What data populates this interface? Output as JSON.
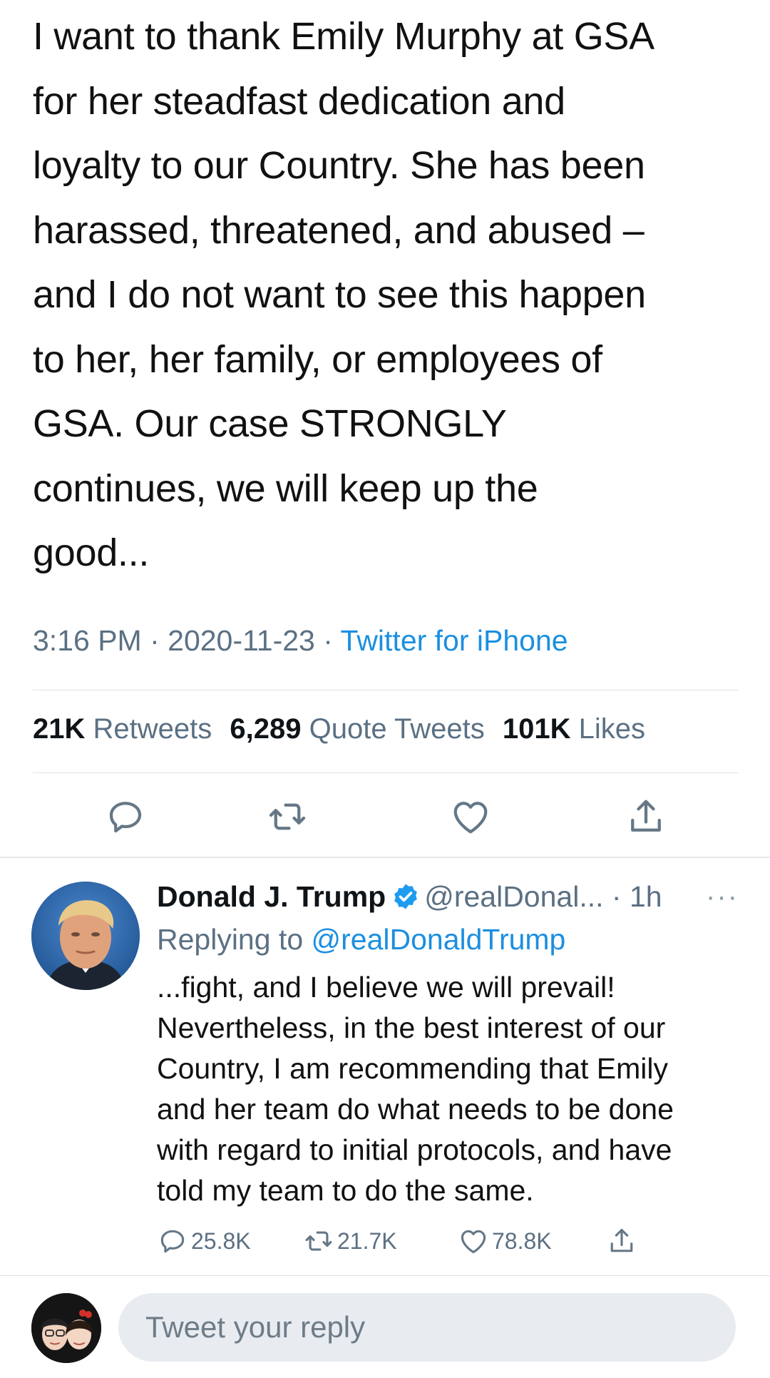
{
  "main_tweet": {
    "text_lines": [
      "I want to thank Emily Murphy at GSA",
      "for her steadfast dedication and",
      "loyalty to our Country. She has been",
      "harassed, threatened, and abused –",
      "and I do not want to see this happen",
      "to her, her family, or employees of",
      "GSA. Our case STRONGLY",
      "continues, we will keep up the",
      "good..."
    ],
    "time": "3:16 PM",
    "separator": " · ",
    "date": "2020-11-23",
    "source": "Twitter for iPhone",
    "stats": {
      "retweets_count": "21K",
      "retweets_label": "Retweets",
      "quotes_count": "6,289",
      "quotes_label": "Quote Tweets",
      "likes_count": "101K",
      "likes_label": "Likes"
    },
    "actions": [
      "reply-icon",
      "retweet-icon",
      "like-icon",
      "share-icon"
    ]
  },
  "reply_tweet": {
    "name": "Donald J. Trump",
    "handle": "@realDonal...",
    "time_sep": " · ",
    "time": "1h",
    "more": "···",
    "replying_prefix": "Replying to ",
    "replying_handle": "@realDonaldTrump",
    "text_lines": [
      "...fight, and I believe we will prevail!",
      "Nevertheless, in the best interest of our",
      "Country, I am recommending that Emily",
      "and her team do what needs to be done",
      "with regard to initial protocols, and have",
      "told my team to do the same."
    ],
    "replies": "25.8K",
    "retweets": "21.7K",
    "likes": "78.8K"
  },
  "reply_box": {
    "placeholder": "Tweet your reply"
  },
  "colors": {
    "link_blue": "#1b8fe0",
    "meta_gray": "#5b7083",
    "verified_blue": "#1d9bf0"
  }
}
